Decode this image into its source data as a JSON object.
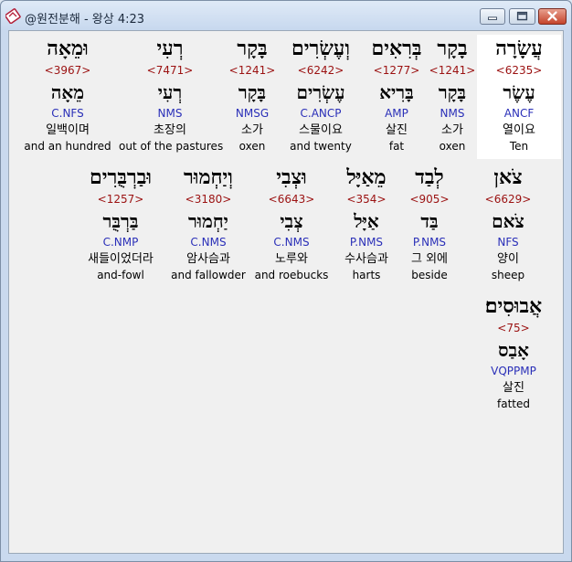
{
  "window": {
    "title": "@원전분해 - 왕상 4:23",
    "icon": "bible-app-icon"
  },
  "words": [
    {
      "hebrew": "עֲשָׂרָה",
      "strong": "<6235>",
      "lemma": "עֶשֶׂר",
      "morph": "ANCF",
      "korean": "열이요",
      "english": "Ten",
      "highlighted": true
    },
    {
      "hebrew": "בָקָר",
      "strong": "<1241>",
      "lemma": "בָּקָר",
      "morph": "NMS",
      "korean": "소가",
      "english": "oxen"
    },
    {
      "hebrew": "בְּרִאִים",
      "strong": "<1277>",
      "lemma": "בָּרִיא",
      "morph": "AMP",
      "korean": "살진",
      "english": "fat"
    },
    {
      "hebrew": "וְעֶשְׂרִים",
      "strong": "<6242>",
      "lemma": "עֶשְׂרִים",
      "morph": "C.ANCP",
      "korean": "스물이요",
      "english": "and twenty"
    },
    {
      "hebrew": "בָּקָר",
      "strong": "<1241>",
      "lemma": "בָּקָר",
      "morph": "NMSG",
      "korean": "소가",
      "english": "oxen"
    },
    {
      "hebrew": "רְעִי",
      "strong": "<7471>",
      "lemma": "רְעִי",
      "morph": "NMS",
      "korean": "초장의",
      "english": "out of the pastures"
    },
    {
      "hebrew": "וּמֵאָה",
      "strong": "<3967>",
      "lemma": "מֵאָה",
      "morph": "C.NFS",
      "korean": "일백이며",
      "english": "and an hundred"
    },
    {
      "hebrew": "צֹאן",
      "strong": "<6629>",
      "lemma": "צֹאם",
      "morph": "NFS",
      "korean": "양이",
      "english": "sheep"
    },
    {
      "hebrew": "לְבַד",
      "strong": "<905>",
      "lemma": "בַּד",
      "morph": "P.NMS",
      "korean": "그 외에",
      "english": "beside"
    },
    {
      "hebrew": "מֵאַיָּל",
      "strong": "<354>",
      "lemma": "אַיָּל",
      "morph": "P.NMS",
      "korean": "수사슴과",
      "english": "harts"
    },
    {
      "hebrew": "וּצְבִי",
      "strong": "<6643>",
      "lemma": "צְבִי",
      "morph": "C.NMS",
      "korean": "노루와",
      "english": "and roebucks"
    },
    {
      "hebrew": "וְיַחְמוּר",
      "strong": "<3180>",
      "lemma": "יַחְמוּר",
      "morph": "C.NMS",
      "korean": "암사슴과",
      "english": "and fallowder"
    },
    {
      "hebrew": "וּבַרְבֻּרִים",
      "strong": "<1257>",
      "lemma": "בַּרְבֻּר",
      "morph": "C.NMP",
      "korean": "새들이었더라",
      "english": "and-fowl"
    },
    {
      "hebrew": "אֲבוּסִים׃",
      "strong": "<75>",
      "lemma": "אָבַס",
      "morph": "VQPPMP",
      "korean": "살진",
      "english": "fatted"
    }
  ],
  "colors": {
    "strong": "#9b1111",
    "morph": "#2a2fb8",
    "highlight": "#ffffff",
    "background": "#f0f0f0"
  }
}
